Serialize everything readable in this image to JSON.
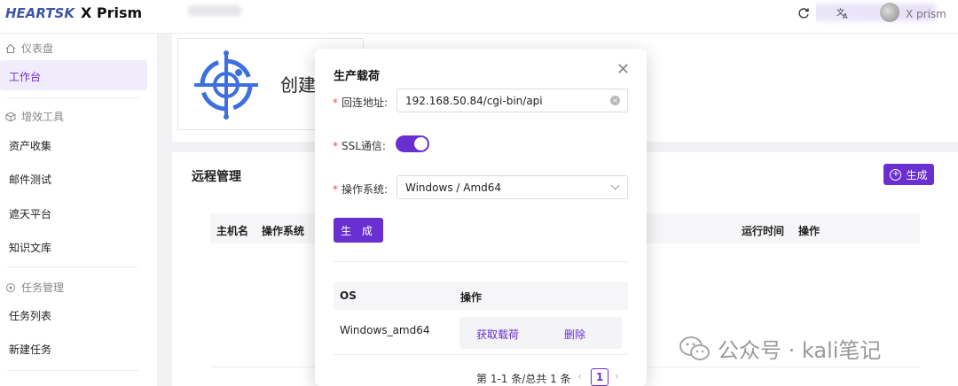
{
  "header": {
    "logo": "HEARTSK",
    "app_name": "X Prism",
    "username": "X prism",
    "refresh_icon": "refresh-icon",
    "translate_icon": "translate-icon"
  },
  "sidebar": {
    "groups": [
      {
        "label": "仪表盘",
        "icon": "home-icon"
      },
      {
        "label": "增效工具",
        "icon": "cube-icon"
      },
      {
        "label": "任务管理",
        "icon": "target-icon"
      }
    ],
    "items": [
      {
        "label": "工作台",
        "active": true
      },
      {
        "label": "资产收集"
      },
      {
        "label": "邮件测试"
      },
      {
        "label": "遮天平台"
      },
      {
        "label": "知识文库"
      },
      {
        "label": "任务列表"
      },
      {
        "label": "新建任务"
      }
    ]
  },
  "main": {
    "create_text": "创建",
    "remote_title": "远程管理",
    "generate_button": "生成",
    "table_headers": [
      "主机名",
      "操作系统",
      "运行时间",
      "操作"
    ]
  },
  "modal": {
    "title": "生产载荷",
    "fields": {
      "callback_label": "回连地址:",
      "callback_value": "192.168.50.84/cgi-bin/api",
      "ssl_label": "SSL通信:",
      "ssl_enabled": true,
      "os_label": "操作系统:",
      "os_value": "Windows / Amd64"
    },
    "submit_label": "生 成",
    "table": {
      "headers": [
        "OS",
        "操作"
      ],
      "rows": [
        {
          "os": "Windows_amd64",
          "actions": [
            "获取载荷",
            "删除"
          ]
        }
      ]
    },
    "pagination": {
      "summary": "第 1-1 条/总共 1 条",
      "current_page": "1"
    }
  },
  "watermark": "公众号 · kali笔记",
  "colors": {
    "accent": "#6a2fd0",
    "logo": "#3e55a8",
    "required": "#e34a4a"
  }
}
